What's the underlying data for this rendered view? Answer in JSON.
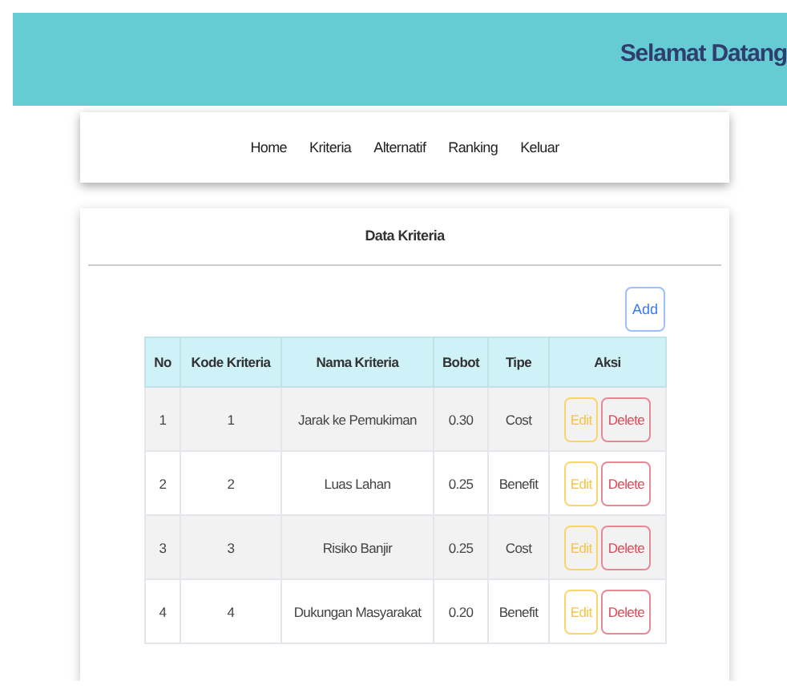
{
  "header": {
    "title": "Selamat Datang"
  },
  "nav": {
    "items": [
      {
        "label": "Home"
      },
      {
        "label": "Kriteria"
      },
      {
        "label": "Alternatif"
      },
      {
        "label": "Ranking"
      },
      {
        "label": "Keluar"
      }
    ]
  },
  "card": {
    "title": "Data Kriteria",
    "add_button": "Add"
  },
  "table": {
    "columns": [
      "No",
      "Kode Kriteria",
      "Nama Kriteria",
      "Bobot",
      "Tipe",
      "Aksi"
    ],
    "rows": [
      {
        "no": "1",
        "kode": "1",
        "nama": "Jarak ke Pemukiman",
        "bobot": "0.30",
        "tipe": "Cost",
        "actions": [
          "Edit",
          "Delete"
        ]
      },
      {
        "no": "2",
        "kode": "2",
        "nama": "Luas Lahan",
        "bobot": "0.25",
        "tipe": "Benefit",
        "actions": [
          "Edit",
          "Delete"
        ]
      },
      {
        "no": "3",
        "kode": "3",
        "nama": "Risiko Banjir",
        "bobot": "0.25",
        "tipe": "Cost",
        "actions": [
          "Edit",
          "Delete"
        ]
      },
      {
        "no": "4",
        "kode": "4",
        "nama": "Dukungan Masyarakat",
        "bobot": "0.20",
        "tipe": "Benefit",
        "actions": [
          "Edit",
          "Delete"
        ]
      }
    ]
  }
}
